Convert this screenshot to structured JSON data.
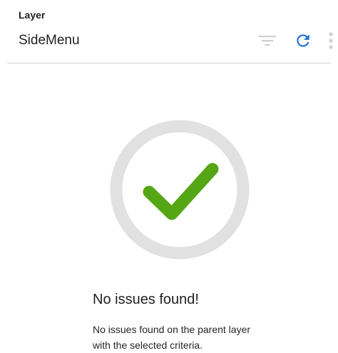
{
  "panel": {
    "section_label": "Layer",
    "layer_name": "SideMenu"
  },
  "toolbar": {
    "filter_icon": "filter-icon",
    "refresh_icon": "refresh-icon",
    "more_icon": "more-vert-icon",
    "refresh_color": "#1f6fd6",
    "filter_color": "#cfcfcf"
  },
  "empty_state": {
    "icon": "check-icon",
    "ring_color": "#e1e1e1",
    "check_color": "#55a614",
    "title": "No issues found!",
    "description": "No issues found on the parent layer with the selected criteria."
  }
}
